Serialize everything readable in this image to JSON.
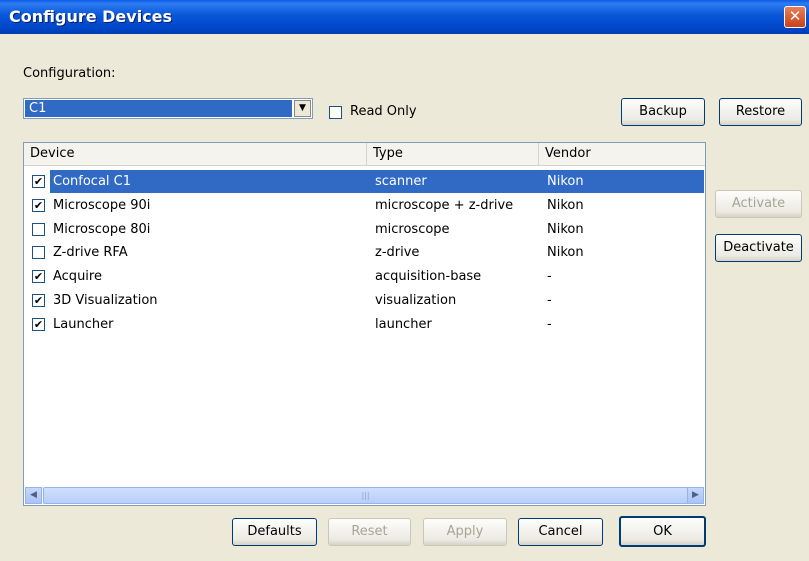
{
  "window": {
    "title": "Configure Devices",
    "close_glyph": "✕"
  },
  "configuration": {
    "label": "Configuration:",
    "selected": "C1",
    "read_only_label": "Read Only",
    "read_only_checked": false
  },
  "buttons": {
    "backup": "Backup",
    "restore": "Restore",
    "activate": "Activate",
    "deactivate": "Deactivate",
    "defaults": "Defaults",
    "reset": "Reset",
    "apply": "Apply",
    "cancel": "Cancel",
    "ok": "OK"
  },
  "table": {
    "columns": [
      "Device",
      "Type",
      "Vendor"
    ],
    "rows": [
      {
        "checked": true,
        "device": "Confocal C1",
        "type": "scanner",
        "vendor": "Nikon",
        "selected": true
      },
      {
        "checked": true,
        "device": "Microscope 90i",
        "type": "microscope + z-drive",
        "vendor": "Nikon",
        "selected": false
      },
      {
        "checked": false,
        "device": "Microscope 80i",
        "type": "microscope",
        "vendor": "Nikon",
        "selected": false
      },
      {
        "checked": false,
        "device": "Z-drive RFA",
        "type": "z-drive",
        "vendor": "Nikon",
        "selected": false
      },
      {
        "checked": true,
        "device": "Acquire",
        "type": "acquisition-base",
        "vendor": "-",
        "selected": false
      },
      {
        "checked": true,
        "device": "3D Visualization",
        "type": "visualization",
        "vendor": "-",
        "selected": false
      },
      {
        "checked": true,
        "device": "Launcher",
        "type": "launcher",
        "vendor": "-",
        "selected": false
      }
    ]
  },
  "colors": {
    "title_bar": "#0054e3",
    "selection": "#316ac5",
    "dialog_bg": "#ece9d8"
  }
}
